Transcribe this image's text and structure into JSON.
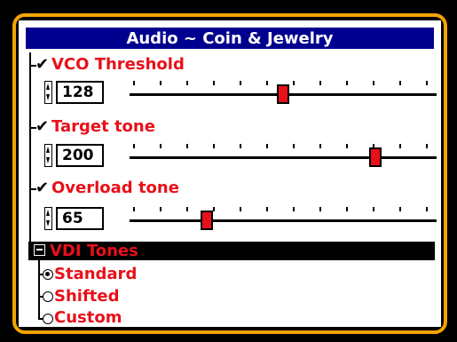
{
  "header": {
    "title": "Audio ~ Coin & Jewelry"
  },
  "settings": [
    {
      "label": "VCO Threshold",
      "check": "✔",
      "value": "128",
      "level": 0.5
    },
    {
      "label": "Target tone",
      "check": "✔",
      "value": "200",
      "level": 0.8
    },
    {
      "label": "Overload tone",
      "check": "✔",
      "value": "65",
      "level": 0.25
    }
  ],
  "vdi": {
    "label": "VDI Tones",
    "options": [
      {
        "label": "Standard",
        "selected": true
      },
      {
        "label": "Shifted",
        "selected": false
      },
      {
        "label": "Custom",
        "selected": false
      }
    ]
  },
  "colors": {
    "title_bar": "#00008f",
    "accent_text": "#e8101a",
    "frame_border": "#f4a300"
  }
}
